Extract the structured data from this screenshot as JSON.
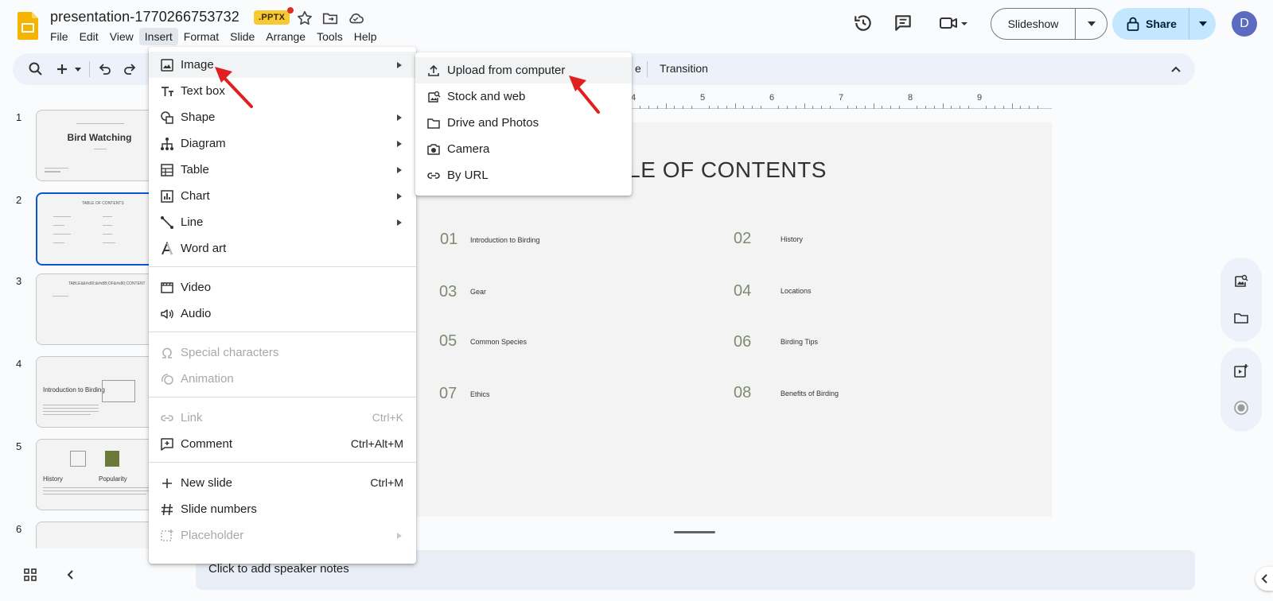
{
  "header": {
    "doc_title": "presentation-1770266753732",
    "badge": ".PPTX",
    "menus": [
      "File",
      "Edit",
      "View",
      "Insert",
      "Format",
      "Slide",
      "Arrange",
      "Tools",
      "Help"
    ],
    "active_menu": "Insert",
    "slideshow_label": "Slideshow",
    "share_label": "Share",
    "avatar_initial": "D"
  },
  "toolbar": {
    "tab_hint": "e",
    "transition_label": "Transition"
  },
  "ruler": {
    "labels": [
      "4",
      "5",
      "6",
      "7",
      "8",
      "9"
    ]
  },
  "filmstrip": {
    "slides": [
      {
        "num": "1",
        "title": "Bird Watching"
      },
      {
        "num": "2",
        "title": "TABLE OF CONTENTS"
      },
      {
        "num": "3",
        "title": "TABLEâ&#x80;&#x8B;OF&#x80;CONTENT"
      },
      {
        "num": "4",
        "title": "Introduction to Birding"
      },
      {
        "num": "5",
        "caption_a": "History",
        "caption_b": "Popularity"
      },
      {
        "num": "6"
      }
    ]
  },
  "slide": {
    "title": "BLE OF CONTENTS",
    "items": [
      {
        "num": "01",
        "label": "Introduction to Birding"
      },
      {
        "num": "02",
        "label": "History"
      },
      {
        "num": "03",
        "label": "Gear"
      },
      {
        "num": "04",
        "label": "Locations"
      },
      {
        "num": "05",
        "label": "Common Species"
      },
      {
        "num": "06",
        "label": "Birding Tips"
      },
      {
        "num": "07",
        "label": "Ethics"
      },
      {
        "num": "08",
        "label": "Benefits of Birding"
      }
    ]
  },
  "speaker_notes": {
    "placeholder": "Click to add speaker notes"
  },
  "insert_menu": {
    "image": "Image",
    "text_box": "Text box",
    "shape": "Shape",
    "diagram": "Diagram",
    "table": "Table",
    "chart": "Chart",
    "line": "Line",
    "word_art": "Word art",
    "video": "Video",
    "audio": "Audio",
    "special_characters": "Special characters",
    "animation": "Animation",
    "link": "Link",
    "link_shortcut": "Ctrl+K",
    "comment": "Comment",
    "comment_shortcut": "Ctrl+Alt+M",
    "new_slide": "New slide",
    "new_slide_shortcut": "Ctrl+M",
    "slide_numbers": "Slide numbers",
    "placeholder": "Placeholder"
  },
  "image_submenu": {
    "upload": "Upload from computer",
    "stock": "Stock and web",
    "drive": "Drive and Photos",
    "camera": "Camera",
    "url": "By URL"
  },
  "colors": {
    "accent_blue": "#0b57d0",
    "share_bg": "#c2e7ff",
    "toc_number": "#7d8b70",
    "annotation_red": "#e02020"
  }
}
